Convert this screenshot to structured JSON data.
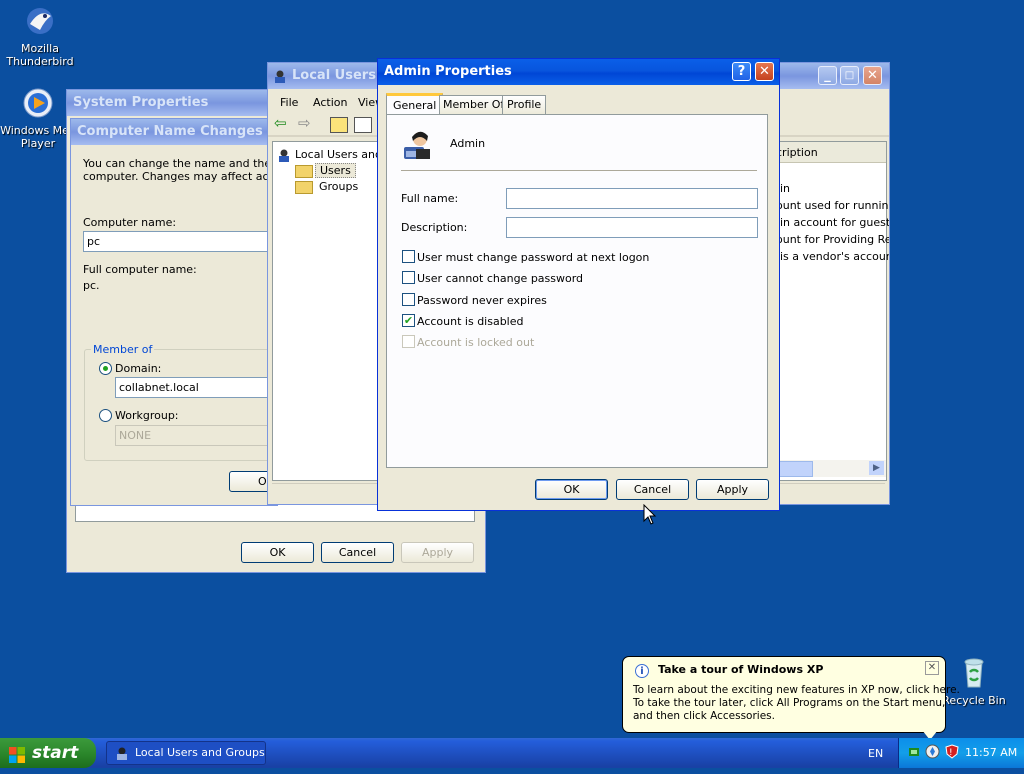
{
  "desktop": {
    "icons": [
      {
        "label_line1": "Mozilla",
        "label_line2": "Thunderbird",
        "icon": "thunderbird-icon"
      },
      {
        "label_line1": "Windows Med",
        "label_line2": "Player",
        "icon": "media-player-icon"
      },
      {
        "label_line1": "Recycle Bin",
        "label_line2": "",
        "icon": "recycle-bin-icon"
      }
    ]
  },
  "system_properties": {
    "title": "System Properties",
    "ok": "OK",
    "cancel": "Cancel",
    "apply": "Apply"
  },
  "computer_name_changes": {
    "title": "Computer Name Changes",
    "intro_line1": "You can change the name and the mer",
    "intro_line2": "computer. Changes may affect access",
    "computer_name_label": "Computer name:",
    "computer_name_value": "pc",
    "full_name_label": "Full computer name:",
    "full_name_value": "pc.",
    "member_of_label": "Member of",
    "domain_label": "Domain:",
    "domain_value": "collabnet.local",
    "workgroup_label": "Workgroup:",
    "workgroup_value": "NONE",
    "ok_partial": "O"
  },
  "local_users": {
    "title": "Local Users a",
    "menu": [
      "File",
      "Action",
      "View"
    ],
    "tree_root": "Local Users and",
    "tree_users": "Users",
    "tree_groups": "Groups",
    "column_header": "cription",
    "rows": [
      "in",
      "ount used for running",
      "-in account for guest a",
      "ount for Providing Rem",
      "is a vendor's account"
    ]
  },
  "admin_properties": {
    "title": "Admin Properties",
    "tabs": [
      "General",
      "Member Of",
      "Profile"
    ],
    "active_tab": "General",
    "user_name": "Admin",
    "full_name_label": "Full name:",
    "full_name_value": "",
    "description_label": "Description:",
    "description_value": "",
    "checkboxes": [
      {
        "label": "User must change password at next logon",
        "checked": false,
        "enabled": true
      },
      {
        "label": "User cannot change password",
        "checked": false,
        "enabled": true
      },
      {
        "label": "Password never expires",
        "checked": false,
        "enabled": true
      },
      {
        "label": "Account is disabled",
        "checked": true,
        "enabled": true
      },
      {
        "label": "Account is locked out",
        "checked": false,
        "enabled": false
      }
    ],
    "ok": "OK",
    "cancel": "Cancel",
    "apply": "Apply"
  },
  "balloon": {
    "title": "Take a tour of Windows XP",
    "line1": "To learn about the exciting new features in XP now, click here.",
    "line2": "To take the tour later, click All Programs on the Start menu,",
    "line3": "and then click Accessories."
  },
  "taskbar": {
    "start_label": "start",
    "task_button": "Local Users and Groups",
    "language": "EN",
    "clock": "11:57 AM"
  },
  "colors": {
    "desktop": "#0b4fa0",
    "active_title": "#0855dd",
    "dialog_face": "#ece9d8",
    "start_green": "#2c882c",
    "balloon_bg": "#ffffe1"
  }
}
